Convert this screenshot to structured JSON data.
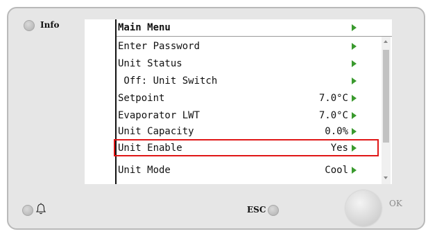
{
  "info": {
    "label": "Info"
  },
  "buttons": {
    "esc_label": "ESC",
    "ok_label": "OK"
  },
  "icons": {
    "bell": "bell-icon",
    "arrow": "right-triangle-icon"
  },
  "colors": {
    "arrow": "#3a9a2e",
    "highlight": "#e01616"
  },
  "menu": {
    "title": "Main Menu",
    "items": [
      {
        "label": "Enter Password",
        "value": ""
      },
      {
        "label": "Unit Status",
        "value": ""
      },
      {
        "label": " Off: Unit Switch",
        "value": ""
      },
      {
        "label": "Setpoint",
        "value": "7.0°C"
      },
      {
        "label": "Evaporator LWT",
        "value": "7.0°C"
      },
      {
        "label": "Unit Capacity",
        "value": "0.0%"
      },
      {
        "label": "Unit Enable",
        "value": "Yes",
        "selected": true
      },
      {
        "label": "Unit Mode",
        "value": "Cool"
      }
    ]
  }
}
